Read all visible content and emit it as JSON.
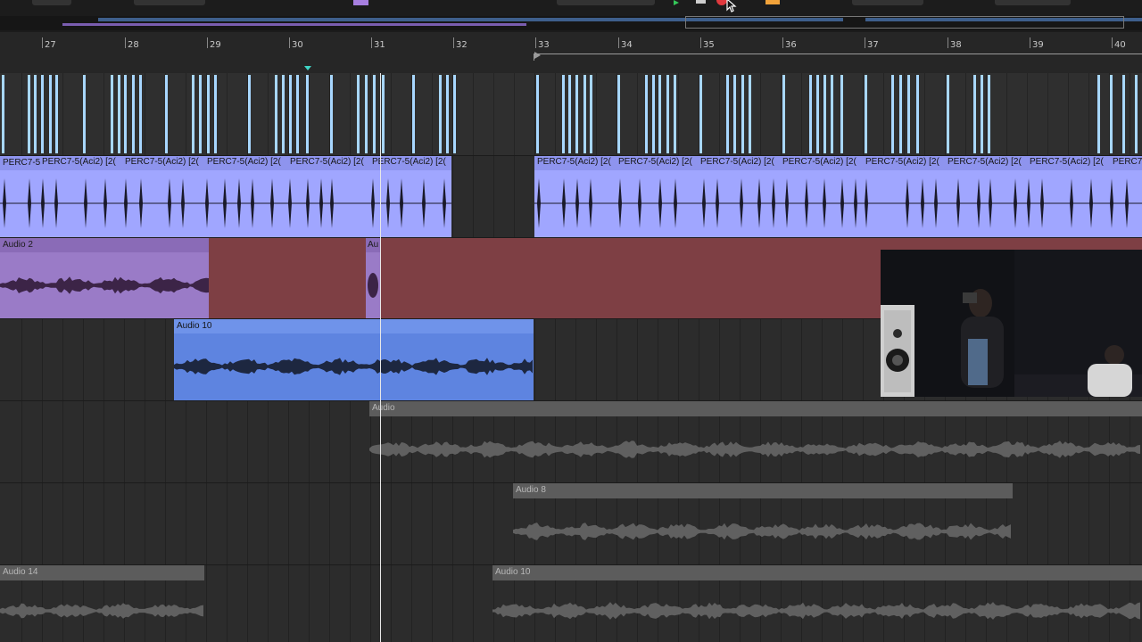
{
  "ruler": {
    "bars": [
      "27",
      "28",
      "29",
      "30",
      "31",
      "32",
      "33",
      "34",
      "35",
      "36",
      "37",
      "38",
      "39",
      "40"
    ]
  },
  "tracks": {
    "perc_clip_name": "PERC7-5(Aci2) [2(",
    "perc_clip_name_short": "PERC7-5",
    "audio2_label": "Audio 2",
    "audio2b_label": "Au",
    "audio10_label": "Audio 10",
    "audio_label": "Audio",
    "audio8_label": "Audio 8",
    "audio14_label": "Audio 14",
    "audio10b_label": "Audio 10"
  },
  "colors": {
    "perc_clip": "#a0a6ff",
    "midi_notes": "#a8d7ff",
    "audio2_clip": "#9a7bc7",
    "audio_red_region": "#7e3f44",
    "audio10_clip": "#5e84e0",
    "grey_clip": "#5c5c5c",
    "transport_play": "#34c759",
    "transport_record": "#e0393e",
    "transport_arm": "#f2a33a"
  },
  "icons": {
    "play": "play-icon",
    "stop": "stop-icon",
    "record": "record-icon",
    "cursor": "mouse-cursor-icon"
  }
}
